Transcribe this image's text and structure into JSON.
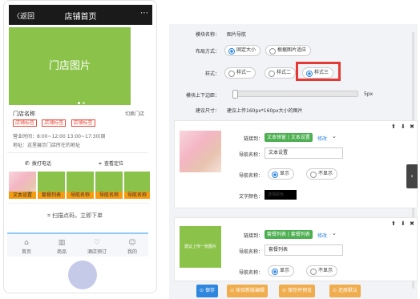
{
  "phone": {
    "header": {
      "back_label": "〈返回",
      "title": "店铺首页",
      "more": "⋯"
    },
    "banner_text": "门店图片",
    "store_name": "门店名称",
    "switch_store": "切换门店",
    "tags": [
      "店铺标签",
      "店铺标签",
      "店铺标签"
    ],
    "hours": "营业时间：8:00~12:00 13:00~17:30(周",
    "address": "地址：这里展示门店所在的地址",
    "call_label": "拨打电话",
    "locate_label": "查看定位",
    "nav_items": [
      "文本设置",
      "套餐列表",
      "导航名称",
      "导航名称",
      "导航名称"
    ],
    "scan_label": "扫描点码，立即下单",
    "footer": [
      {
        "icon": "⌂",
        "label": "首页"
      },
      {
        "icon": "▥",
        "label": "商品"
      },
      {
        "icon": "♡",
        "label": "酒店预订"
      },
      {
        "icon": "☺",
        "label": "我的"
      }
    ]
  },
  "config": {
    "module_name_label": "模块名称：",
    "module_name_value": "图片导航",
    "layout_label": "布局方式：",
    "layout_options": [
      "固定大小",
      "根据图片适应"
    ],
    "style_label": "样式：",
    "style_options": [
      "样式一",
      "样式二",
      "样式三"
    ],
    "margin_label": "模块上下边距：",
    "margin_value": "5px",
    "size_label": "建议尺寸：",
    "size_value": "建议上传160px*160px大小的图片",
    "cards": [
      {
        "link_label": "链接到：",
        "link_tag": "文本弹窗 | 文本设置",
        "edit_label": "修改",
        "name_label": "导航名称：",
        "name_value": "文本设置",
        "show_label": "导航名称：",
        "show_options": [
          "显示",
          "不显示"
        ],
        "color_label": "文字颜色：",
        "color_value": "选择颜色"
      },
      {
        "thumb_text": "建议上传一张图片",
        "link_label": "链接到：",
        "link_tag": "套餐列表 | 套餐列表",
        "edit_label": "修改",
        "name_label": "导航名称：",
        "name_value": "套餐列表",
        "show_label": "导航名称：",
        "show_options": [
          "显示",
          "不显示"
        ]
      }
    ],
    "card_controls": [
      "⬆",
      "⬇",
      "✖"
    ],
    "buttons": [
      "保存",
      "体验新版编辑",
      "保存并预览",
      "还原默认"
    ],
    "side_tab_icon": "›"
  },
  "colors": {
    "accent_green": "#8bc34a",
    "accent_blue": "#2e86de",
    "highlight_red": "#e53935",
    "tag_red": "#e74c3c",
    "button_orange": "#f0ad4e"
  }
}
